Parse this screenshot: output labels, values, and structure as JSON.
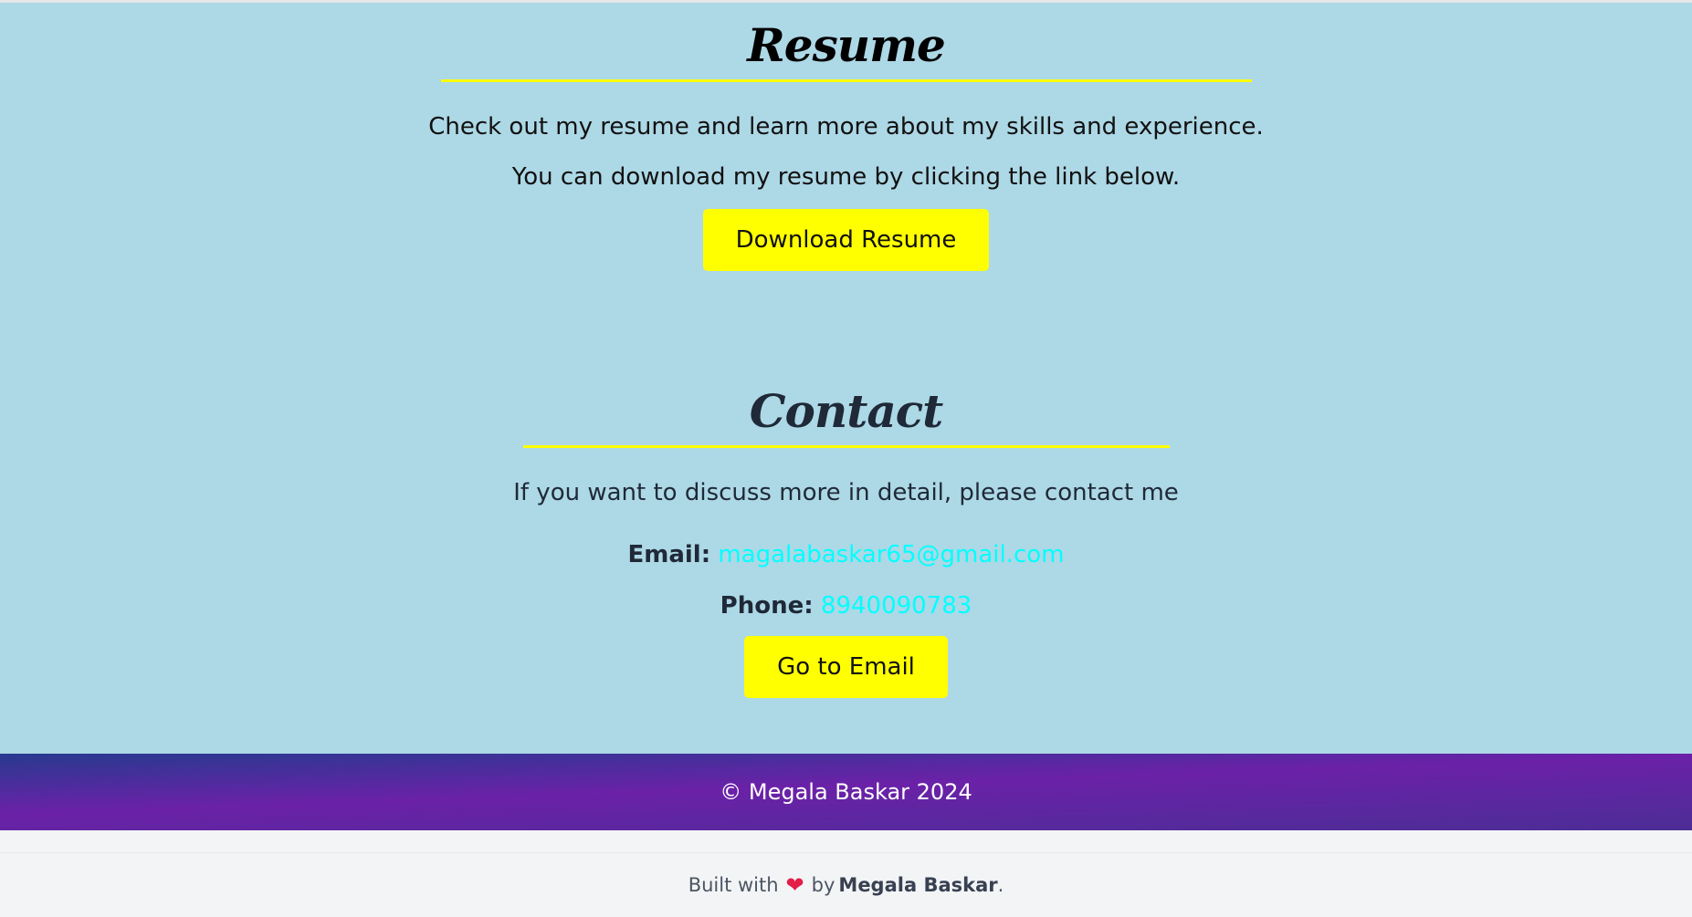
{
  "resume": {
    "title": "Resume",
    "line1": "Check out my resume and learn more about my skills and experience.",
    "line2": "You can download my resume by clicking the link below.",
    "button": "Download Resume"
  },
  "contact": {
    "title": "Contact",
    "intro": "If you want to discuss more in detail, please contact me",
    "email_label": "Email:",
    "email_value": "magalabaskar65@gmail.com",
    "phone_label": "Phone:",
    "phone_value": "8940090783",
    "button": "Go to Email"
  },
  "footer": {
    "copyright": "© Megala Baskar 2024"
  },
  "built": {
    "prefix": "Built with",
    "heart_icon": "heart-icon",
    "by": "by",
    "author": "Megala Baskar",
    "suffix": "."
  },
  "colors": {
    "background": "#add8e6",
    "accent": "#ffff00",
    "link": "#00ffff",
    "footer_gradient_start": "#283a8f",
    "footer_gradient_mid": "#6b21a8"
  }
}
